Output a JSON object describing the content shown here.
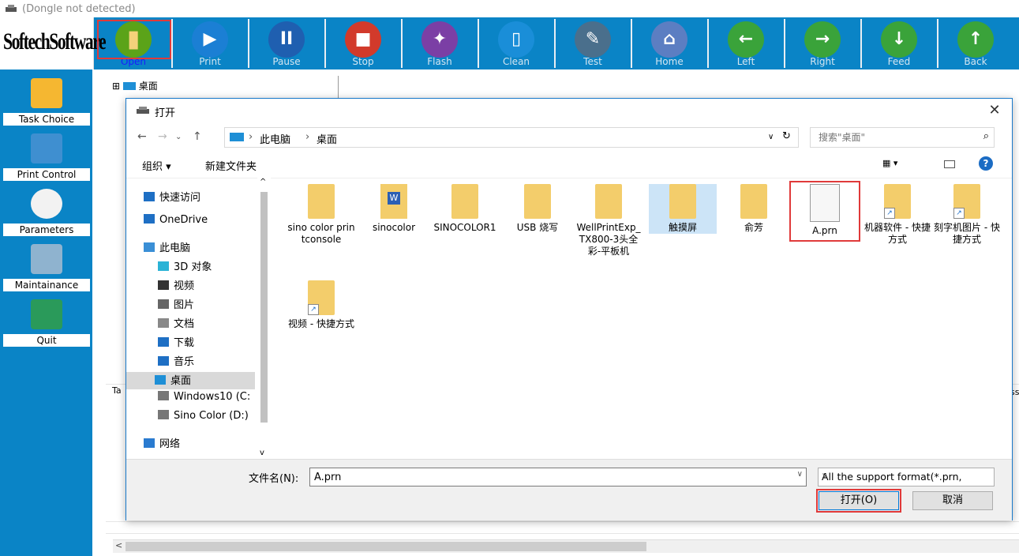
{
  "app": {
    "title": "(Dongle not detected)",
    "logo": "SoftechSoftware"
  },
  "toolbar": [
    {
      "label": "Open",
      "icon": "folder-icon",
      "color": "#5ba319"
    },
    {
      "label": "Print",
      "icon": "play-icon",
      "color": "#1b7fd4"
    },
    {
      "label": "Pause",
      "icon": "pause-icon",
      "color": "#1f5fb0"
    },
    {
      "label": "Stop",
      "icon": "stop-icon",
      "color": "#d23a2b"
    },
    {
      "label": "Flash",
      "icon": "flash-icon",
      "color": "#7b3fa5"
    },
    {
      "label": "Clean",
      "icon": "clean-icon",
      "color": "#1a8ed8"
    },
    {
      "label": "Test",
      "icon": "test-icon",
      "color": "#4a6f8c"
    },
    {
      "label": "Home",
      "icon": "home-icon",
      "color": "#5c7ec2"
    },
    {
      "label": "Left",
      "icon": "arrow-left-icon",
      "color": "#3aa33a"
    },
    {
      "label": "Right",
      "icon": "arrow-right-icon",
      "color": "#3aa33a"
    },
    {
      "label": "Feed",
      "icon": "arrow-down-icon",
      "color": "#3aa33a"
    },
    {
      "label": "Back",
      "icon": "arrow-up-icon",
      "color": "#3aa33a"
    }
  ],
  "sidebar": [
    {
      "label": "Task Choice",
      "icon": "folder-icon"
    },
    {
      "label": "Print Control",
      "icon": "print-control-icon"
    },
    {
      "label": "Parameters",
      "icon": "gear-icon"
    },
    {
      "label": "Maintainance",
      "icon": "tools-icon"
    },
    {
      "label": "Quit",
      "icon": "quit-icon"
    }
  ],
  "background": {
    "tree_root": "桌面",
    "tab_fragment": "Ta",
    "right_fragment": "ss"
  },
  "dialog": {
    "title": "打开",
    "address": [
      "此电脑",
      "桌面"
    ],
    "search_placeholder": "搜索\"桌面\"",
    "organize": "组织 ▾",
    "new_folder": "新建文件夹",
    "nav": [
      {
        "label": "快速访问",
        "icon": "star-icon"
      },
      {
        "label": "OneDrive",
        "icon": "cloud-icon"
      },
      {
        "label": "此电脑",
        "icon": "computer-icon"
      },
      {
        "label": "3D 对象",
        "icon": "cube-icon"
      },
      {
        "label": "视频",
        "icon": "video-icon"
      },
      {
        "label": "图片",
        "icon": "picture-icon"
      },
      {
        "label": "文档",
        "icon": "document-icon"
      },
      {
        "label": "下载",
        "icon": "download-icon"
      },
      {
        "label": "音乐",
        "icon": "music-icon"
      },
      {
        "label": "桌面",
        "icon": "desktop-icon"
      },
      {
        "label": "Windows10 (C:",
        "icon": "drive-icon"
      },
      {
        "label": "Sino Color (D:)",
        "icon": "drive-icon"
      },
      {
        "label": "网络",
        "icon": "network-icon"
      }
    ],
    "files": [
      {
        "name": "sino color printconsole",
        "type": "folder"
      },
      {
        "name": "sinocolor",
        "type": "word"
      },
      {
        "name": "SINOCOLOR1",
        "type": "folder"
      },
      {
        "name": "USB 烧写",
        "type": "folder"
      },
      {
        "name": "WellPrintExp_TX800-3头全彩-平板机",
        "type": "folder"
      },
      {
        "name": "触摸屏",
        "type": "folder"
      },
      {
        "name": "俞芳",
        "type": "folder"
      },
      {
        "name": "A.prn",
        "type": "file"
      },
      {
        "name": "机器软件 - 快捷方式",
        "type": "shortcut"
      },
      {
        "name": "刻字机图片 - 快捷方式",
        "type": "shortcut"
      },
      {
        "name": "视频 - 快捷方式",
        "type": "shortcut"
      }
    ],
    "filename_label": "文件名(N):",
    "filename_value": "A.prn",
    "filter": "All the support format(*.prn,",
    "open_button": "打开(O)",
    "cancel_button": "取消"
  }
}
